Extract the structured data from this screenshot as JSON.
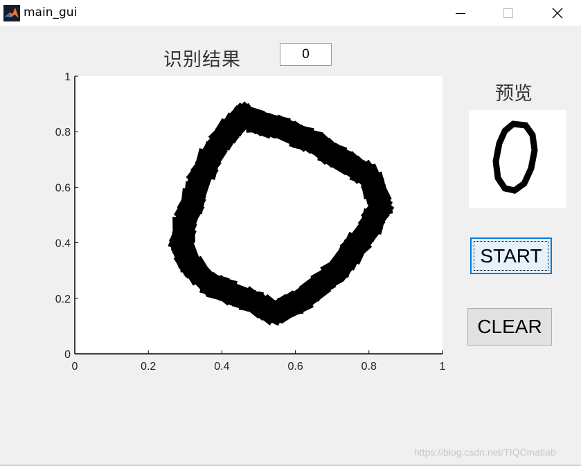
{
  "window": {
    "title": "main_gui",
    "controls": [
      "minimize",
      "maximize",
      "close"
    ]
  },
  "result": {
    "label": "识别结果",
    "value": "0"
  },
  "preview": {
    "label": "预览",
    "digit_shape": "0"
  },
  "buttons": {
    "start_label": "START",
    "clear_label": "CLEAR"
  },
  "chart_data": {
    "type": "scatter",
    "title": "",
    "xlabel": "",
    "ylabel": "",
    "xlim": [
      0,
      1
    ],
    "ylim": [
      0,
      1
    ],
    "x_ticks": [
      "0",
      "0.2",
      "0.4",
      "0.6",
      "0.8",
      "1"
    ],
    "y_ticks": [
      "0",
      "0.2",
      "0.4",
      "0.6",
      "0.8",
      "1"
    ],
    "grid": false,
    "series": [
      {
        "marker": "square",
        "color": "#000000",
        "x": [
          0.46,
          0.5,
          0.55,
          0.6,
          0.65,
          0.7,
          0.75,
          0.8,
          0.82,
          0.83,
          0.8,
          0.76,
          0.72,
          0.66,
          0.6,
          0.54,
          0.48,
          0.42,
          0.36,
          0.31,
          0.29,
          0.3,
          0.32,
          0.34,
          0.37,
          0.41
        ],
        "y": [
          0.86,
          0.83,
          0.82,
          0.79,
          0.76,
          0.72,
          0.68,
          0.64,
          0.58,
          0.53,
          0.45,
          0.38,
          0.31,
          0.24,
          0.18,
          0.15,
          0.19,
          0.22,
          0.26,
          0.33,
          0.4,
          0.47,
          0.55,
          0.63,
          0.71,
          0.79
        ]
      }
    ]
  }
}
